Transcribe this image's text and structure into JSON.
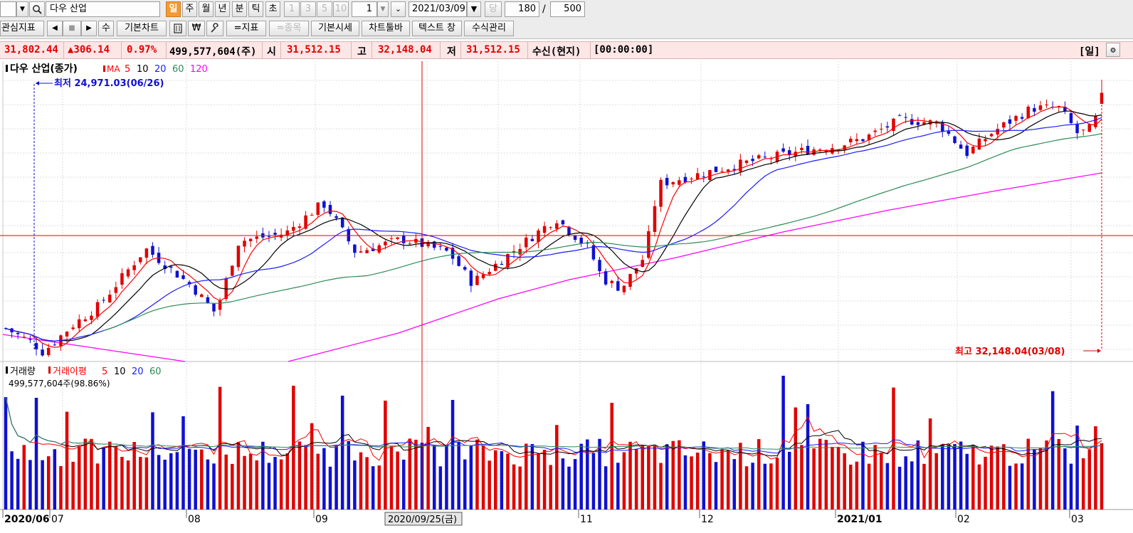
{
  "toolbar1": {
    "symbol_name": "다우 산업",
    "period_buttons": [
      {
        "label": "일",
        "selected": true
      },
      {
        "label": "주",
        "selected": false
      },
      {
        "label": "월",
        "selected": false
      },
      {
        "label": "년",
        "selected": false
      },
      {
        "label": "분",
        "selected": false
      },
      {
        "label": "틱",
        "selected": false
      },
      {
        "label": "초",
        "selected": false
      }
    ],
    "interval_buttons": [
      "1",
      "3",
      "5",
      "10"
    ],
    "interval_value": "1",
    "date": "2021/03/09",
    "current_label": "당",
    "display_count": "180",
    "separator": "/",
    "max_count": "500"
  },
  "toolbar2": {
    "buttons": [
      "관심지표",
      "기본차트",
      "₩",
      "=지표",
      "=종목",
      "기본시세",
      "차트툴바",
      "텍스트 창",
      "수식관리"
    ],
    "stock_button": "수"
  },
  "infobar": {
    "price": "31,802.44",
    "change": "▲306.14",
    "change_pct": "0.97%",
    "volume": "499,577,604(주)",
    "open_label": "시",
    "open": "31,512.15",
    "high_label": "고",
    "high": "32,148.04",
    "low_label": "저",
    "low": "31,512.15",
    "feed": "수신(현지)",
    "time": "[00:00:00]",
    "period": "[일]"
  },
  "price_panel": {
    "title": "다우 산업(종가)",
    "ma_label": "MA",
    "ma_periods": [
      "5",
      "10",
      "20",
      "60",
      "120"
    ],
    "low_annotation": "최저 24,971.03(06/26)",
    "high_annotation": "최고 32,148.04(03/08)"
  },
  "volume_panel": {
    "title": "거래량",
    "ma_title": "거래이평",
    "ma_periods": [
      "5",
      "10",
      "20",
      "60"
    ],
    "value_text": "499,577,604주(98.86%)"
  },
  "x_axis": {
    "labels": [
      "2020/06",
      "07",
      "08",
      "09",
      "11",
      "12",
      "2021/01",
      "02",
      "03"
    ],
    "cursor_label": "2020/09/25(금)"
  },
  "colors": {
    "up": "#e00000",
    "down": "#1010d0",
    "ma5": "#ff0000",
    "ma10": "#000000",
    "ma20": "#1c1cff",
    "ma60": "#2e8b57",
    "ma120": "#ff00ff",
    "crosshair": "#e00000"
  },
  "icons": [
    "search-icon",
    "chevron-down-icon",
    "calendar-dropdown-icon",
    "arrow-left-icon",
    "stop-icon",
    "arrow-right-icon",
    "settings-gear-icon"
  ]
}
